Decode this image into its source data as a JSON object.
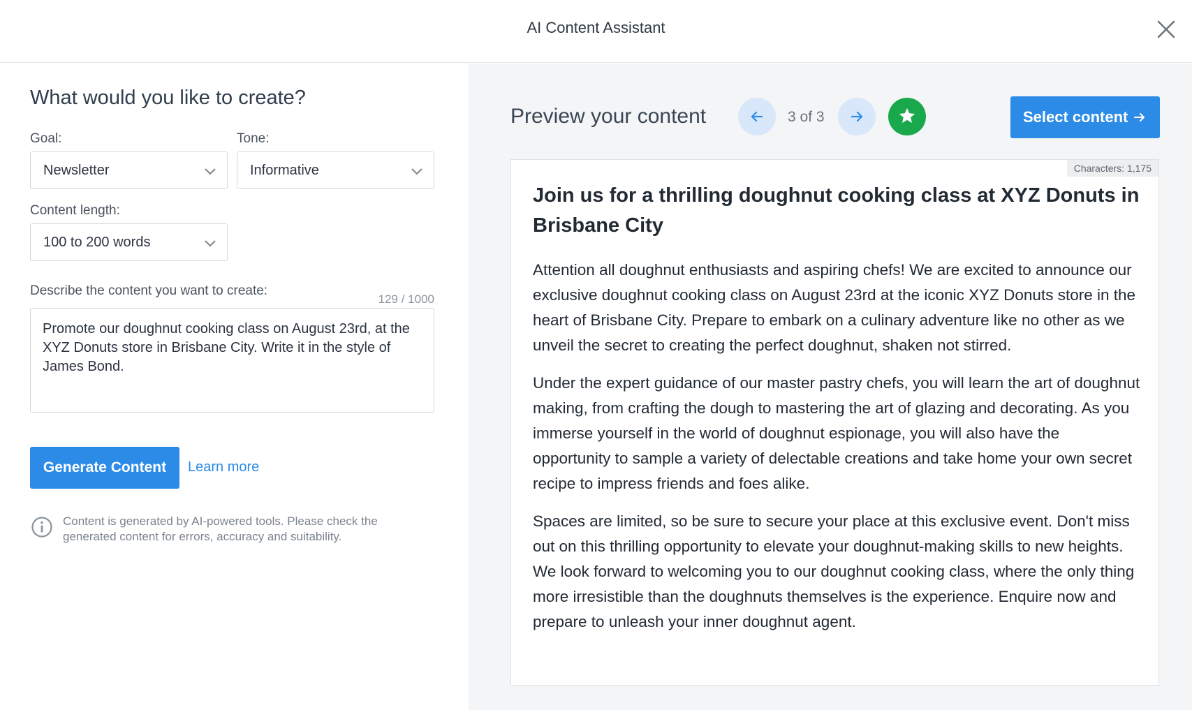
{
  "header": {
    "title": "AI Content Assistant"
  },
  "form": {
    "heading": "What would you like to create?",
    "goal_label": "Goal:",
    "goal_value": "Newsletter",
    "tone_label": "Tone:",
    "tone_value": "Informative",
    "length_label": "Content length:",
    "length_value": "100 to 200 words",
    "describe_label": "Describe the content you want to create:",
    "char_counter": "129 / 1000",
    "description": "Promote our doughnut cooking class on August 23rd, at the XYZ Donuts store in Brisbane City. Write it in the style of James Bond.",
    "generate_label": "Generate Content",
    "learn_more_label": "Learn more",
    "disclaimer": "Content is generated by AI-powered tools. Please check the generated content for errors, accuracy and suitability."
  },
  "preview": {
    "title": "Preview your content",
    "pager": "3 of 3",
    "select_label": "Select content",
    "characters": "Characters: 1,175",
    "heading": "Join us for a thrilling doughnut cooking class at XYZ Donuts in Brisbane City",
    "paragraphs": [
      "Attention all doughnut enthusiasts and aspiring chefs! We are excited to announce our exclusive doughnut cooking class on August 23rd at the iconic XYZ Donuts store in the heart of Brisbane City. Prepare to embark on a culinary adventure like no other as we unveil the secret to creating the perfect doughnut, shaken not stirred.",
      "Under the expert guidance of our master pastry chefs, you will learn the art of doughnut making, from crafting the dough to mastering the art of glazing and decorating. As you immerse yourself in the world of doughnut espionage, you will also have the opportunity to sample a variety of delectable creations and take home your own secret recipe to impress friends and foes alike.",
      "Spaces are limited, so be sure to secure your place at this exclusive event. Don't miss out on this thrilling opportunity to elevate your doughnut-making skills to new heights. We look forward to welcoming you to our doughnut cooking class, where the only thing more irresistible than the doughnuts themselves is the experience. Enquire now and prepare to unleash your inner doughnut agent."
    ]
  },
  "colors": {
    "primary": "#2b8be6",
    "favorite": "#19a84b",
    "nav_circle": "#d8e8fa",
    "panel_bg": "#f4f5f7"
  },
  "icons": [
    "close-icon",
    "chevron-down-icon",
    "info-icon",
    "arrow-left-icon",
    "arrow-right-icon",
    "star-icon"
  ]
}
